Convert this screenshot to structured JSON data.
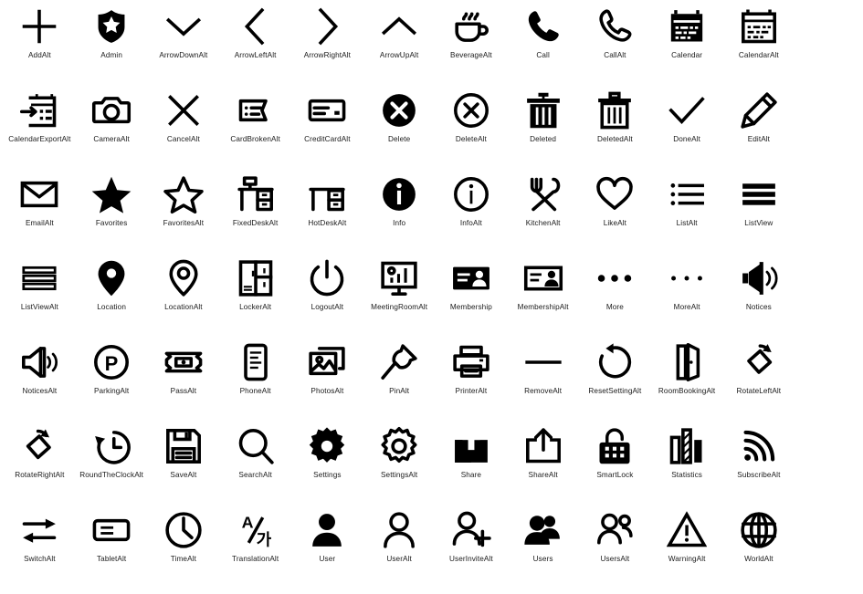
{
  "page": {
    "title": "Icon Set Sheet",
    "background_color": "#ffffff",
    "icon_color": "#000000",
    "label_color": "#1a1a1a",
    "columns": 12,
    "rows": 7,
    "icon_count": 84
  },
  "icons": [
    {
      "name": "AddAlt",
      "glyph": "plus"
    },
    {
      "name": "Admin",
      "glyph": "shield-star"
    },
    {
      "name": "ArrowDownAlt",
      "glyph": "chevron-down"
    },
    {
      "name": "ArrowLeftAlt",
      "glyph": "chevron-left"
    },
    {
      "name": "ArrowRightAlt",
      "glyph": "chevron-right"
    },
    {
      "name": "ArrowUpAlt",
      "glyph": "chevron-up"
    },
    {
      "name": "BeverageAlt",
      "glyph": "coffee-cup"
    },
    {
      "name": "Call",
      "glyph": "phone-filled"
    },
    {
      "name": "CallAlt",
      "glyph": "phone-outline"
    },
    {
      "name": "Calendar",
      "glyph": "calendar-filled"
    },
    {
      "name": "CalendarAlt",
      "glyph": "calendar-outline"
    },
    {
      "name": "CalendarExportAlt",
      "glyph": "calendar-export"
    },
    {
      "name": "CameraAlt",
      "glyph": "camera"
    },
    {
      "name": "CancelAlt",
      "glyph": "x-cross"
    },
    {
      "name": "CardBrokenAlt",
      "glyph": "card-broken"
    },
    {
      "name": "CreditCardAlt",
      "glyph": "credit-card"
    },
    {
      "name": "Delete",
      "glyph": "x-circle-filled"
    },
    {
      "name": "DeleteAlt",
      "glyph": "x-circle-outline"
    },
    {
      "name": "Deleted",
      "glyph": "trash-filled"
    },
    {
      "name": "DeletedAlt",
      "glyph": "trash-outline"
    },
    {
      "name": "DoneAlt",
      "glyph": "checkmark"
    },
    {
      "name": "EditAlt",
      "glyph": "pencil"
    },
    {
      "name": "EmailAlt",
      "glyph": "envelope"
    },
    {
      "name": "Favorites",
      "glyph": "star-filled"
    },
    {
      "name": "FavoritesAlt",
      "glyph": "star-outline"
    },
    {
      "name": "FixedDeskAlt",
      "glyph": "fixed-desk"
    },
    {
      "name": "HotDeskAlt",
      "glyph": "hot-desk"
    },
    {
      "name": "Info",
      "glyph": "info-filled"
    },
    {
      "name": "InfoAlt",
      "glyph": "info-outline"
    },
    {
      "name": "KitchenAlt",
      "glyph": "fork-spoon"
    },
    {
      "name": "LikeAlt",
      "glyph": "heart-outline"
    },
    {
      "name": "ListAlt",
      "glyph": "bullet-list"
    },
    {
      "name": "ListView",
      "glyph": "list-view-filled"
    },
    {
      "name": "ListViewAlt",
      "glyph": "list-view-outline"
    },
    {
      "name": "Location",
      "glyph": "pin-filled"
    },
    {
      "name": "LocationAlt",
      "glyph": "pin-outline"
    },
    {
      "name": "LockerAlt",
      "glyph": "locker"
    },
    {
      "name": "LogoutAlt",
      "glyph": "power"
    },
    {
      "name": "MeetingRoomAlt",
      "glyph": "monitor-chart"
    },
    {
      "name": "Membership",
      "glyph": "id-card-filled"
    },
    {
      "name": "MembershipAlt",
      "glyph": "id-card-outline"
    },
    {
      "name": "More",
      "glyph": "dots-large"
    },
    {
      "name": "MoreAlt",
      "glyph": "dots-small"
    },
    {
      "name": "Notices",
      "glyph": "megaphone-filled"
    },
    {
      "name": "NoticesAlt",
      "glyph": "megaphone-outline"
    },
    {
      "name": "ParkingAlt",
      "glyph": "parking-p"
    },
    {
      "name": "PassAlt",
      "glyph": "ticket"
    },
    {
      "name": "PhoneAlt",
      "glyph": "mobile-doc"
    },
    {
      "name": "PhotosAlt",
      "glyph": "photos"
    },
    {
      "name": "PinAlt",
      "glyph": "pushpin"
    },
    {
      "name": "PrinterAlt",
      "glyph": "printer"
    },
    {
      "name": "RemoveAlt",
      "glyph": "minus"
    },
    {
      "name": "ResetSettingAlt",
      "glyph": "reset-arrow"
    },
    {
      "name": "RoomBookingAlt",
      "glyph": "open-door"
    },
    {
      "name": "RotateLeftAlt",
      "glyph": "rotate-left"
    },
    {
      "name": "RotateRightAlt",
      "glyph": "rotate-right"
    },
    {
      "name": "RoundTheClockAlt",
      "glyph": "clock-back"
    },
    {
      "name": "SaveAlt",
      "glyph": "floppy-disk"
    },
    {
      "name": "SearchAlt",
      "glyph": "magnifier"
    },
    {
      "name": "Settings",
      "glyph": "gear-filled"
    },
    {
      "name": "SettingsAlt",
      "glyph": "gear-outline"
    },
    {
      "name": "Share",
      "glyph": "share-filled"
    },
    {
      "name": "ShareAlt",
      "glyph": "share-outline"
    },
    {
      "name": "SmartLock",
      "glyph": "smart-lock"
    },
    {
      "name": "Statistics",
      "glyph": "bar-chart"
    },
    {
      "name": "SubscribeAlt",
      "glyph": "rss-waves"
    },
    {
      "name": "SwitchAlt",
      "glyph": "switch-arrows"
    },
    {
      "name": "TabletAlt",
      "glyph": "tablet"
    },
    {
      "name": "TimeAlt",
      "glyph": "clock"
    },
    {
      "name": "TranslationAlt",
      "glyph": "translation-a-ga"
    },
    {
      "name": "User",
      "glyph": "user-filled"
    },
    {
      "name": "UserAlt",
      "glyph": "user-outline"
    },
    {
      "name": "UserInviteAlt",
      "glyph": "user-plus"
    },
    {
      "name": "Users",
      "glyph": "users-filled"
    },
    {
      "name": "UsersAlt",
      "glyph": "users-outline"
    },
    {
      "name": "WarningAlt",
      "glyph": "warning-triangle"
    },
    {
      "name": "WorldAlt",
      "glyph": "globe"
    }
  ],
  "icons_row_order": [
    [
      "AddAlt",
      "Admin",
      "ArrowDownAlt",
      "ArrowLeftAlt",
      "ArrowRightAlt",
      "ArrowUpAlt",
      "BeverageAlt",
      "Call",
      "CallAlt",
      "Calendar",
      "CalendarAlt"
    ],
    [
      "CalendarExportAlt",
      "CameraAlt",
      "CancelAlt",
      "CardBrokenAlt",
      "CreditCardAlt",
      "Delete",
      "DeleteAlt",
      "Deleted",
      "DeletedAlt",
      "DoneAlt",
      "EditAlt"
    ],
    [
      "EmailAlt",
      "Favorites",
      "FavoritesAlt",
      "FixedDeskAlt",
      "HotDeskAlt",
      "Info",
      "InfoAlt",
      "KitchenAlt",
      "LikeAlt",
      "ListAlt",
      "ListView"
    ],
    [
      "ListViewAlt",
      "Location",
      "LocationAlt",
      "LockerAlt",
      "LogoutAlt",
      "MeetingRoomAlt",
      "Membership",
      "MembershipAlt",
      "More",
      "MoreAlt",
      "Notices"
    ],
    [
      "NoticesAlt",
      "ParkingAlt",
      "PassAlt",
      "PhoneAlt",
      "PhotosAlt",
      "PinAlt",
      "PrinterAlt",
      "RemoveAlt",
      "ResetSettingAlt",
      "RoomBookingAlt",
      "RotateLeftAlt"
    ],
    [
      "RotateRightAlt",
      "RoundTheClockAlt",
      "SaveAlt",
      "SearchAlt",
      "Settings",
      "SettingsAlt",
      "Share",
      "ShareAlt",
      "SmartLock",
      "Statistics",
      "SubscribeAlt"
    ],
    [
      "SwitchAlt",
      "TabletAlt",
      "TimeAlt",
      "TranslationAlt",
      "User",
      "UserAlt",
      "UserInviteAlt",
      "Users",
      "UsersAlt",
      "WarningAlt",
      "WorldAlt"
    ]
  ],
  "translation_glyph": {
    "latin": "A",
    "hangul": "가"
  },
  "parking_glyph": {
    "letter": "P"
  }
}
